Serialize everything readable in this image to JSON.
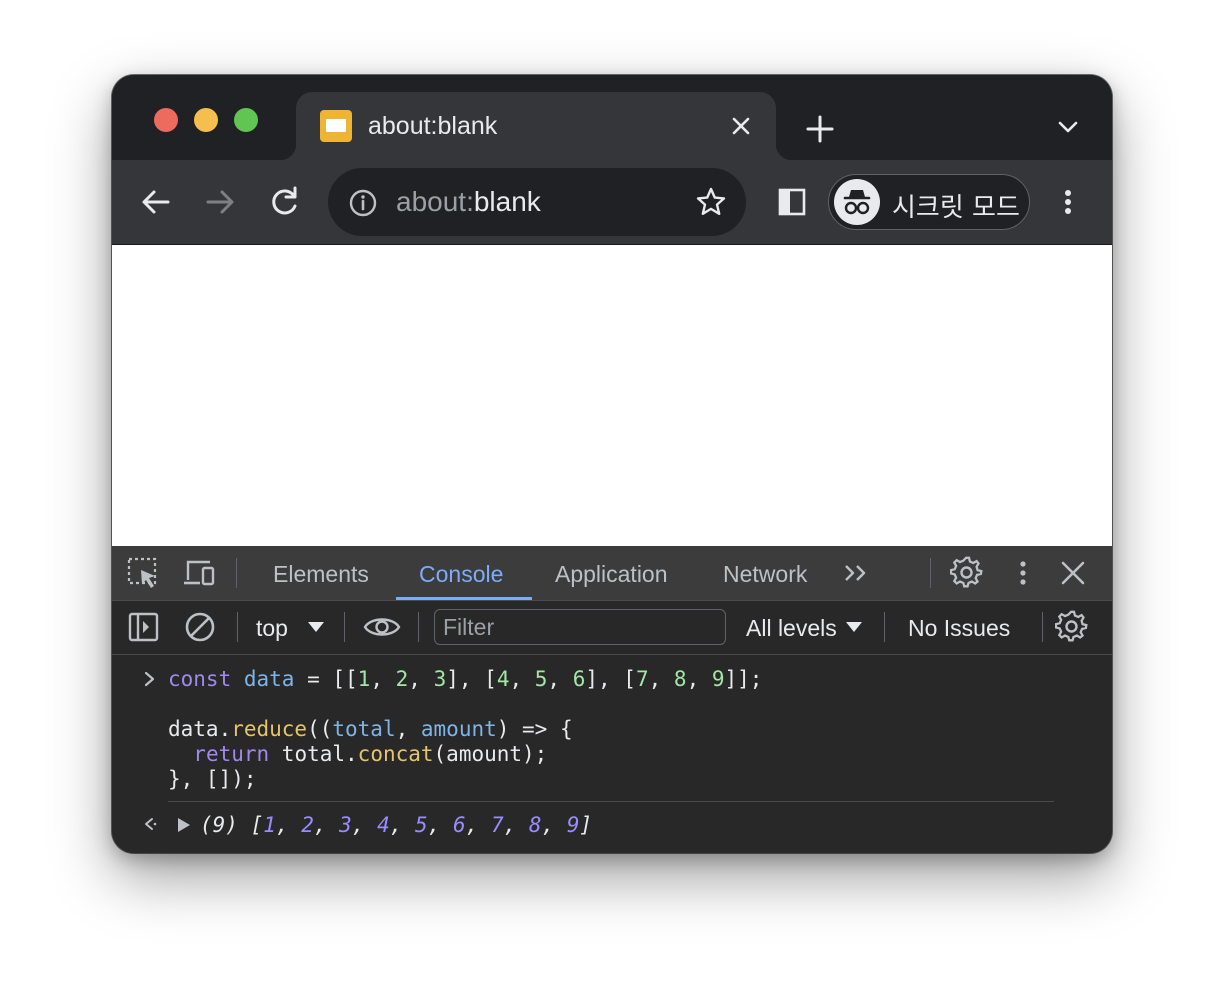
{
  "window": {
    "traffic_lights": [
      "close",
      "minimize",
      "zoom"
    ]
  },
  "tab": {
    "title": "about:blank",
    "favicon": "blank-page-icon"
  },
  "toolbar": {
    "url_prefix": "about:",
    "url_rest": "blank",
    "incognito_label": "시크릿 모드",
    "icons": [
      "back-icon",
      "forward-icon",
      "reload-icon",
      "info-icon",
      "bookmark-star-icon",
      "side-panel-icon",
      "incognito-icon",
      "more-menu-icon"
    ]
  },
  "devtools": {
    "tabs": [
      "Elements",
      "Console",
      "Application",
      "Network"
    ],
    "active_tab": "Console",
    "context": "top",
    "filter_placeholder": "Filter",
    "levels": "All levels",
    "issues": "No Issues"
  },
  "console": {
    "input_lines": [
      "const data = [[1, 2, 3], [4, 5, 6], [7, 8, 9]];",
      "",
      "data.reduce((total, amount) => {",
      "  return total.concat(amount);",
      "}, []);"
    ],
    "result_count": "(9)",
    "result_values": [
      "1",
      "2",
      "3",
      "4",
      "5",
      "6",
      "7",
      "8",
      "9"
    ]
  },
  "colors": {
    "keyword": "#9f8aeb",
    "variable": "#7fb4e6",
    "number": "#a3e6a5",
    "function": "#e5c46b",
    "active_tab": "#7cacf8"
  }
}
